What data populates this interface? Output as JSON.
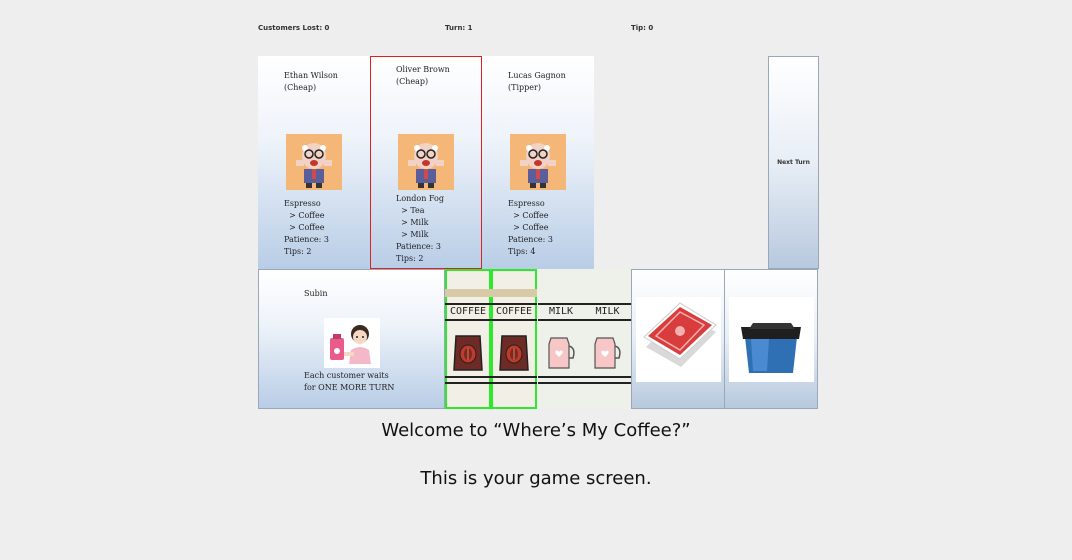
{
  "status": {
    "customers_lost": "Customers Lost: 0",
    "turn": "Turn: 1",
    "tip": "Tip: 0"
  },
  "customers": [
    {
      "name": "Ethan Wilson",
      "type": "(Cheap)",
      "order": "Espresso\n  > Coffee\n  > Coffee",
      "patience": "Patience: 3",
      "tips": "Tips: 2",
      "icon": "customer-face-icon"
    },
    {
      "name": "Oliver Brown",
      "type": "(Cheap)",
      "order": "London Fog\n  > Tea\n  > Milk\n  > Milk",
      "patience": "Patience: 3",
      "tips": "Tips: 2",
      "icon": "customer-face-icon"
    },
    {
      "name": "Lucas Gagnon",
      "type": "(Tipper)",
      "order": "Espresso\n  > Coffee\n  > Coffee",
      "patience": "Patience: 3",
      "tips": "Tips: 4",
      "icon": "customer-face-icon"
    }
  ],
  "next_turn_label": "Next Turn",
  "barista": {
    "name": "Subin",
    "ability": "Each customer waits\nfor ONE MORE TURN",
    "icon": "barista-icon"
  },
  "ingredients": [
    {
      "label": "COFFEE",
      "icon": "coffee-bag-icon",
      "selected": true
    },
    {
      "label": "COFFEE",
      "icon": "coffee-bag-icon",
      "selected": true
    },
    {
      "label": "MILK",
      "icon": "milk-jug-icon",
      "selected": false
    },
    {
      "label": "MILK",
      "icon": "milk-jug-icon",
      "selected": false
    }
  ],
  "tiles": [
    {
      "icon": "card-deck-icon"
    },
    {
      "icon": "trash-bin-icon"
    }
  ],
  "captions": {
    "welcome": "Welcome to “Where’s My Coffee?”",
    "info": "This is your game screen."
  },
  "colors": {
    "selected_customer": "#e02020",
    "selected_ingredient": "#2ee82e",
    "background": "#eeeeee"
  }
}
